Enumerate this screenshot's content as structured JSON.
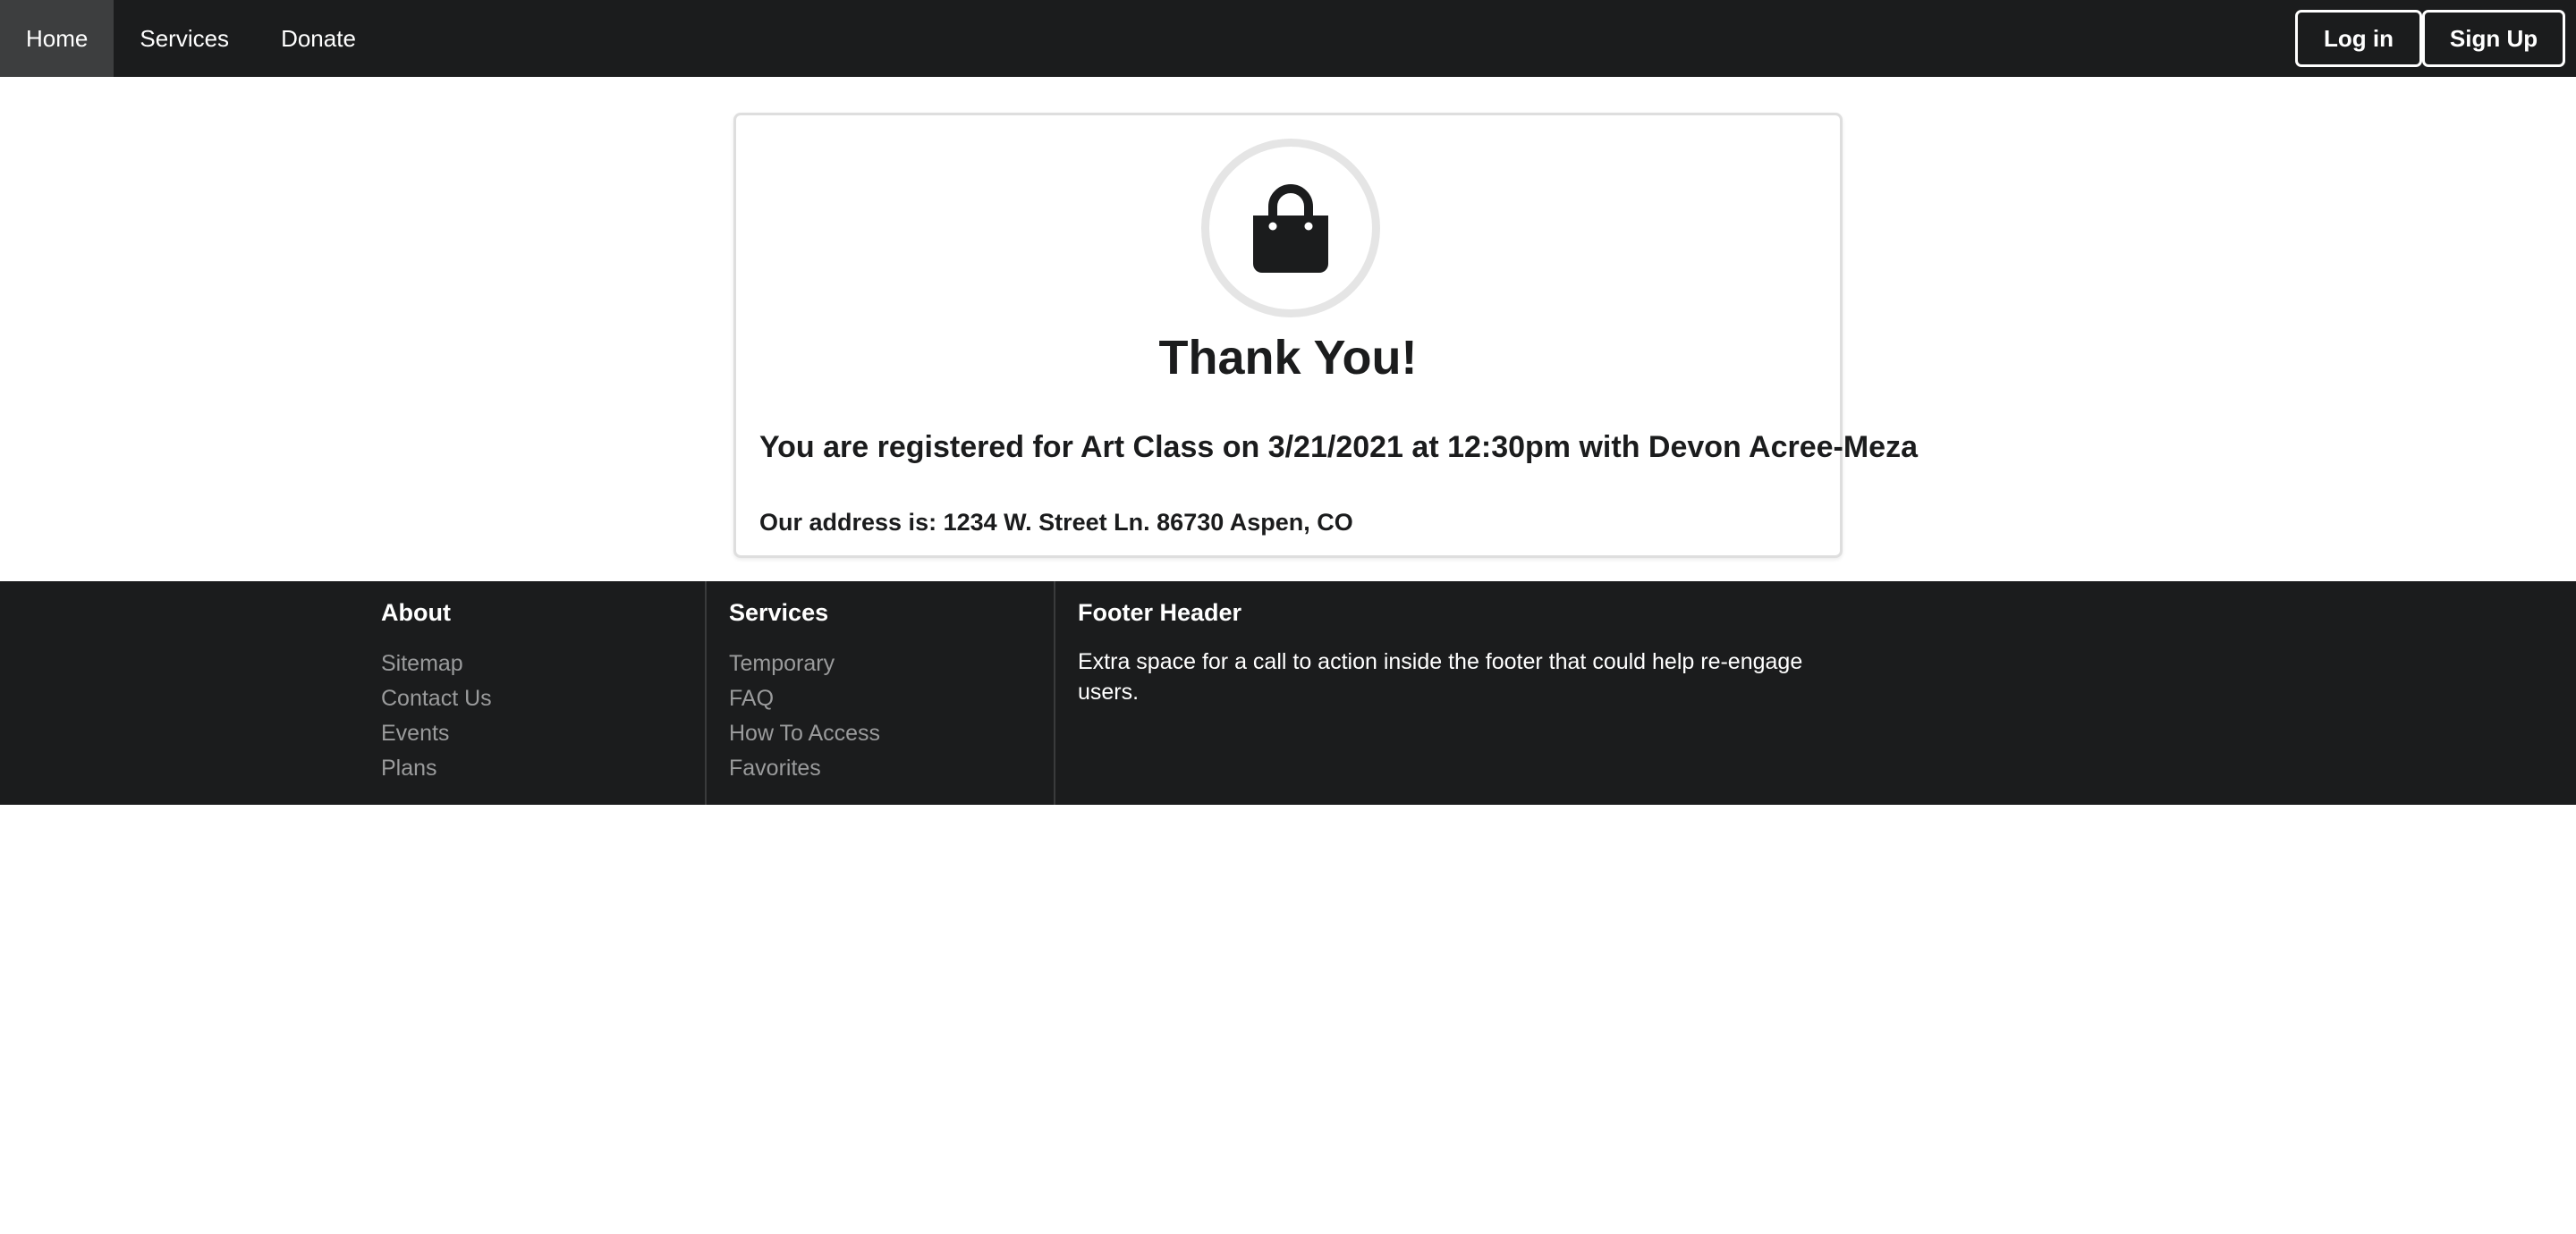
{
  "nav": {
    "items": [
      {
        "label": "Home"
      },
      {
        "label": "Services"
      },
      {
        "label": "Donate"
      }
    ],
    "login_label": "Log in",
    "signup_label": "Sign Up"
  },
  "confirmation": {
    "icon": "shopping-bag-icon",
    "title": "Thank You!",
    "message": "You are registered for Art Class on 3/21/2021 at 12:30pm with Devon Acree-Meza",
    "address": "Our address is: 1234 W. Street Ln. 86730 Aspen, CO"
  },
  "footer": {
    "about": {
      "heading": "About",
      "links": [
        "Sitemap",
        "Contact Us",
        "Events",
        "Plans"
      ]
    },
    "services": {
      "heading": "Services",
      "links": [
        "Temporary",
        "FAQ",
        "How To Access",
        "Favorites"
      ]
    },
    "cta": {
      "heading": "Footer Header",
      "text": "Extra space for a call to action inside the footer that could help re-engage users."
    }
  },
  "colors": {
    "topbar_bg": "#1b1c1d",
    "active_nav_bg": "#3d3e3f",
    "footer_bg": "#1b1c1d",
    "footer_link": "#9a9b9c"
  }
}
